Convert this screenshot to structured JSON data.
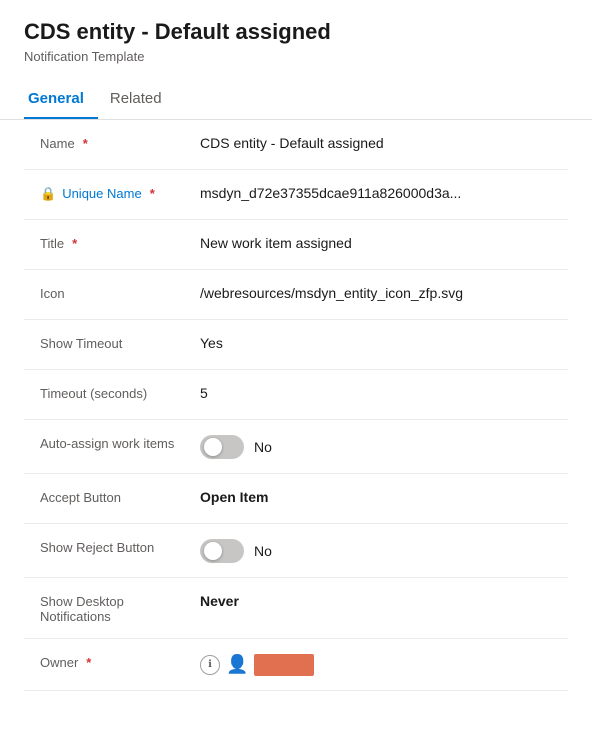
{
  "header": {
    "title": "CDS entity - Default assigned",
    "subtitle": "Notification Template"
  },
  "tabs": [
    {
      "id": "general",
      "label": "General",
      "active": true
    },
    {
      "id": "related",
      "label": "Related",
      "active": false
    }
  ],
  "form": {
    "fields": [
      {
        "id": "name",
        "label": "Name",
        "required": true,
        "locked": false,
        "value": "CDS entity - Default assigned",
        "type": "text"
      },
      {
        "id": "unique-name",
        "label": "Unique Name",
        "required": true,
        "locked": true,
        "value": "msdyn_d72e37355dcae911a826000d3a...",
        "type": "text"
      },
      {
        "id": "title",
        "label": "Title",
        "required": true,
        "locked": false,
        "value": "New work item assigned",
        "type": "text"
      },
      {
        "id": "icon",
        "label": "Icon",
        "required": false,
        "locked": false,
        "value": "/webresources/msdyn_entity_icon_zfp.svg",
        "type": "text"
      },
      {
        "id": "show-timeout",
        "label": "Show Timeout",
        "required": false,
        "locked": false,
        "value": "Yes",
        "type": "text"
      },
      {
        "id": "timeout-seconds",
        "label": "Timeout (seconds)",
        "required": false,
        "locked": false,
        "value": "5",
        "type": "text"
      },
      {
        "id": "auto-assign",
        "label": "Auto-assign work items",
        "required": false,
        "locked": false,
        "value": "No",
        "type": "toggle",
        "toggleOn": false
      },
      {
        "id": "accept-button",
        "label": "Accept Button",
        "required": false,
        "locked": false,
        "value": "Open Item",
        "type": "text",
        "bold": true
      },
      {
        "id": "show-reject-button",
        "label": "Show Reject Button",
        "required": false,
        "locked": false,
        "value": "No",
        "type": "toggle",
        "toggleOn": false
      },
      {
        "id": "show-desktop-notifications",
        "label": "Show Desktop Notifications",
        "required": false,
        "locked": false,
        "value": "Never",
        "type": "text",
        "bold": true
      },
      {
        "id": "owner",
        "label": "Owner",
        "required": true,
        "locked": false,
        "value": "",
        "type": "owner"
      }
    ]
  }
}
